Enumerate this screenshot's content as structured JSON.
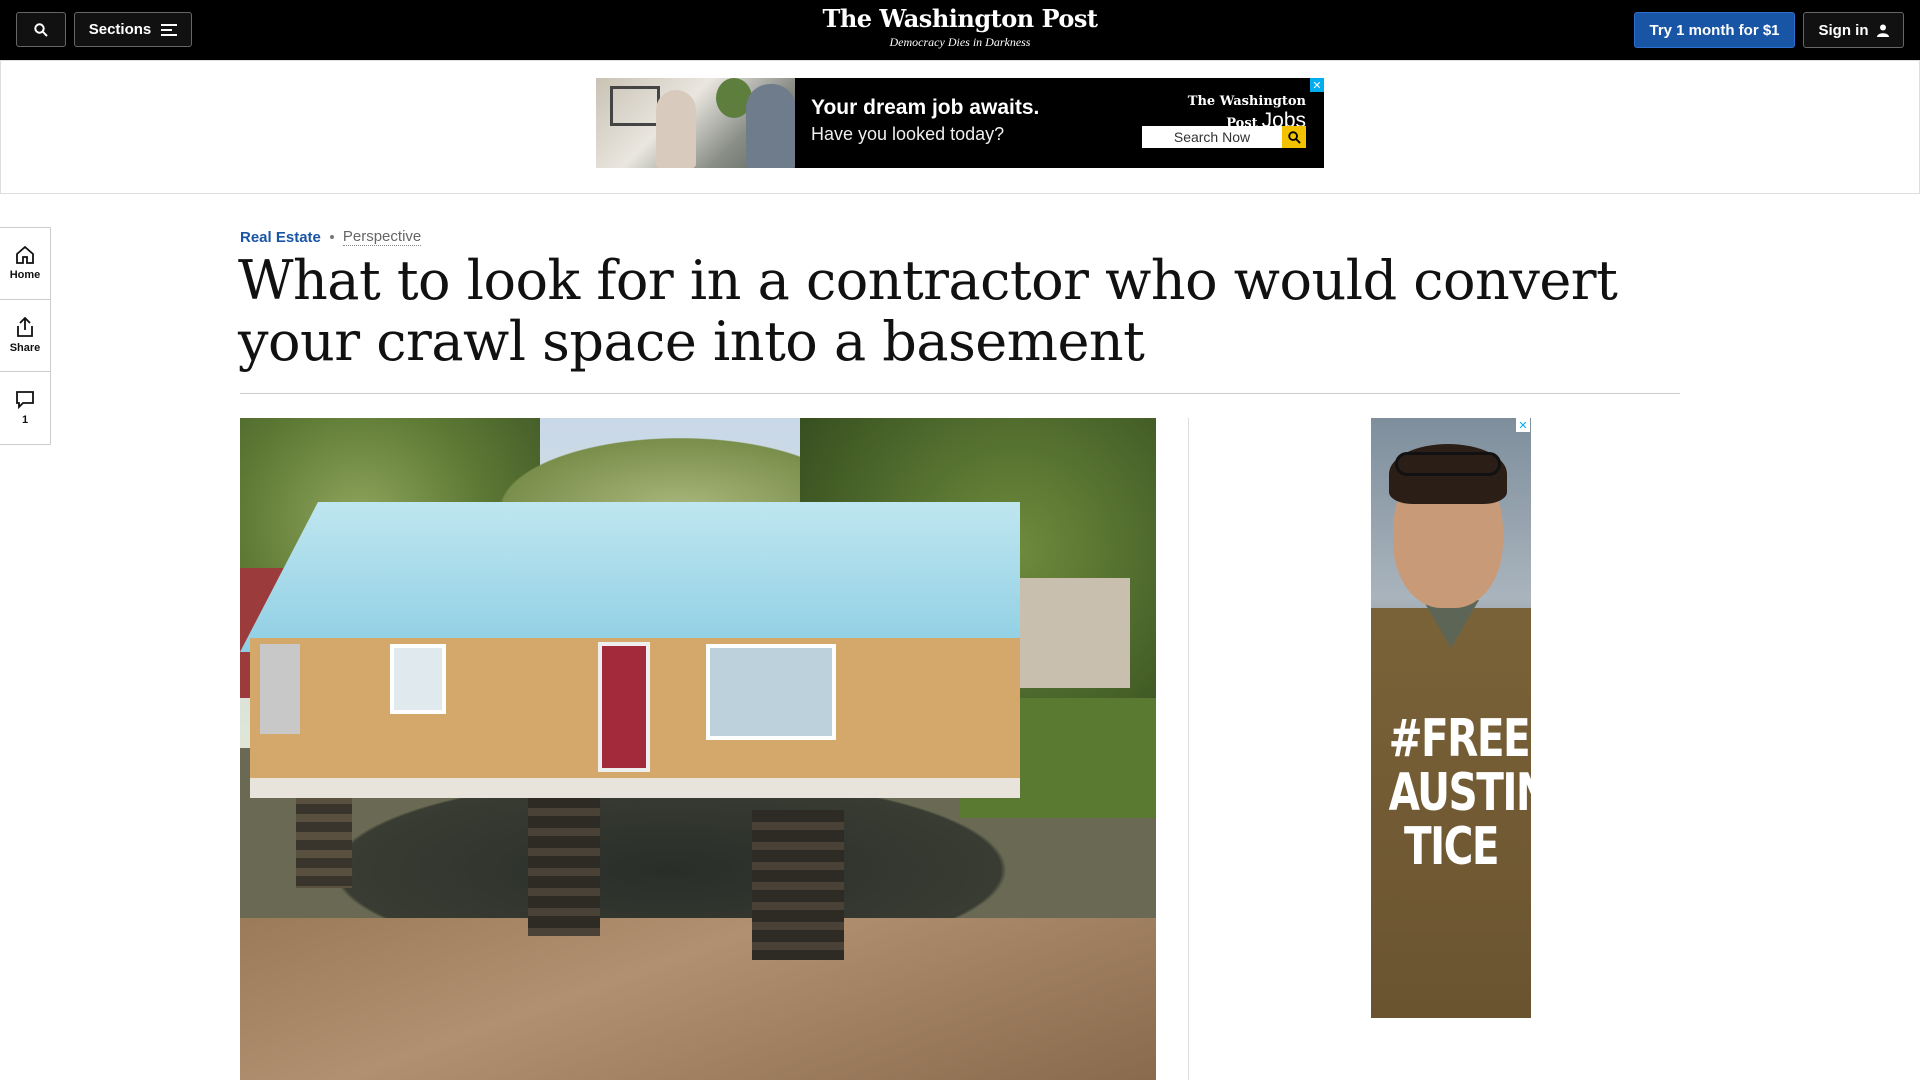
{
  "header": {
    "sections_label": "Sections",
    "logo": "The Washington Post",
    "tagline": "Democracy Dies in Darkness",
    "subscribe_label": "Try 1 month for $1",
    "signin_label": "Sign in"
  },
  "top_ad": {
    "headline": "Your dream job awaits.",
    "subline": "Have you looked today?",
    "brand": "The Washington Post",
    "brand_suffix": "Jobs",
    "search_label": "Search Now",
    "close_glyph": "✕"
  },
  "rail": {
    "home_label": "Home",
    "share_label": "Share",
    "comments_count": "1"
  },
  "article": {
    "section": "Real Estate",
    "label": "Perspective",
    "headline": "What to look for in a contractor who would convert your crawl space into a basement"
  },
  "side_ad": {
    "close_glyph": "✕",
    "line1": "#FREE",
    "line2": "AUSTIN",
    "line3": "TICE"
  },
  "colors": {
    "accent": "#1955a5",
    "topbar": "#000000",
    "ad_close": "#00aeef",
    "search_button": "#f2c200"
  },
  "icons": [
    "search-icon",
    "menu-icon",
    "user-icon",
    "home-icon",
    "share-icon",
    "comment-icon",
    "magnifier-icon"
  ]
}
